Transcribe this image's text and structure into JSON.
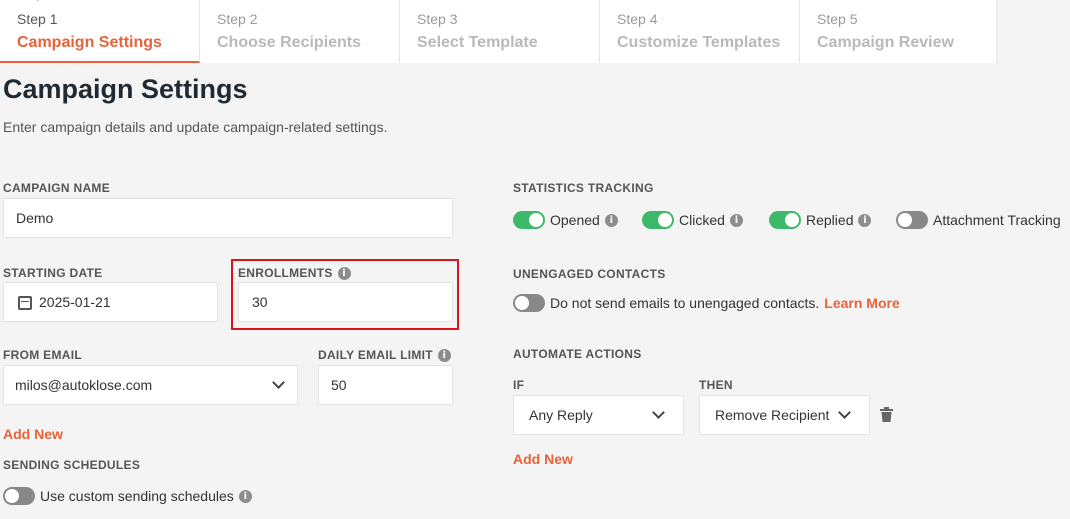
{
  "steps": [
    {
      "number": "Step 1",
      "title": "Campaign Settings"
    },
    {
      "number": "Step 2",
      "title": "Choose Recipients"
    },
    {
      "number": "Step 3",
      "title": "Select Template"
    },
    {
      "number": "Step 4",
      "title": "Customize Templates"
    },
    {
      "number": "Step 5",
      "title": "Campaign Review"
    }
  ],
  "header": {
    "title": "Campaign Settings",
    "subtitle": "Enter campaign details and update campaign-related settings."
  },
  "campaign_name": {
    "label": "CAMPAIGN NAME",
    "value": "Demo"
  },
  "starting_date": {
    "label": "STARTING DATE",
    "value": "2025-01-21"
  },
  "enrollments": {
    "label": "ENROLLMENTS",
    "value": "30"
  },
  "from_email": {
    "label": "FROM EMAIL",
    "value": "milos@autoklose.com"
  },
  "daily_limit": {
    "label": "DAILY EMAIL LIMIT",
    "value": "50"
  },
  "add_new_email": "Add New",
  "sending_schedules": {
    "label": "SENDING SCHEDULES",
    "toggle_label": "Use custom sending schedules",
    "enabled": false
  },
  "statistics": {
    "label": "STATISTICS TRACKING",
    "items": [
      {
        "label": "Opened",
        "enabled": true,
        "info": true
      },
      {
        "label": "Clicked",
        "enabled": true,
        "info": true
      },
      {
        "label": "Replied",
        "enabled": true,
        "info": true
      },
      {
        "label": "Attachment Tracking",
        "enabled": false,
        "info": false
      }
    ]
  },
  "unengaged": {
    "label": "UNENGAGED CONTACTS",
    "toggle_label": "Do not send emails to unengaged contacts.",
    "learn_more": "Learn More",
    "enabled": false
  },
  "automate": {
    "label": "AUTOMATE ACTIONS",
    "if_label": "IF",
    "then_label": "THEN",
    "if_value": "Any Reply",
    "then_value": "Remove Recipient",
    "add_new": "Add New"
  },
  "colors": {
    "accent": "#e8633a",
    "toggle_on": "#3cb96a",
    "toggle_off": "#888888",
    "highlight": "#d8141a"
  }
}
